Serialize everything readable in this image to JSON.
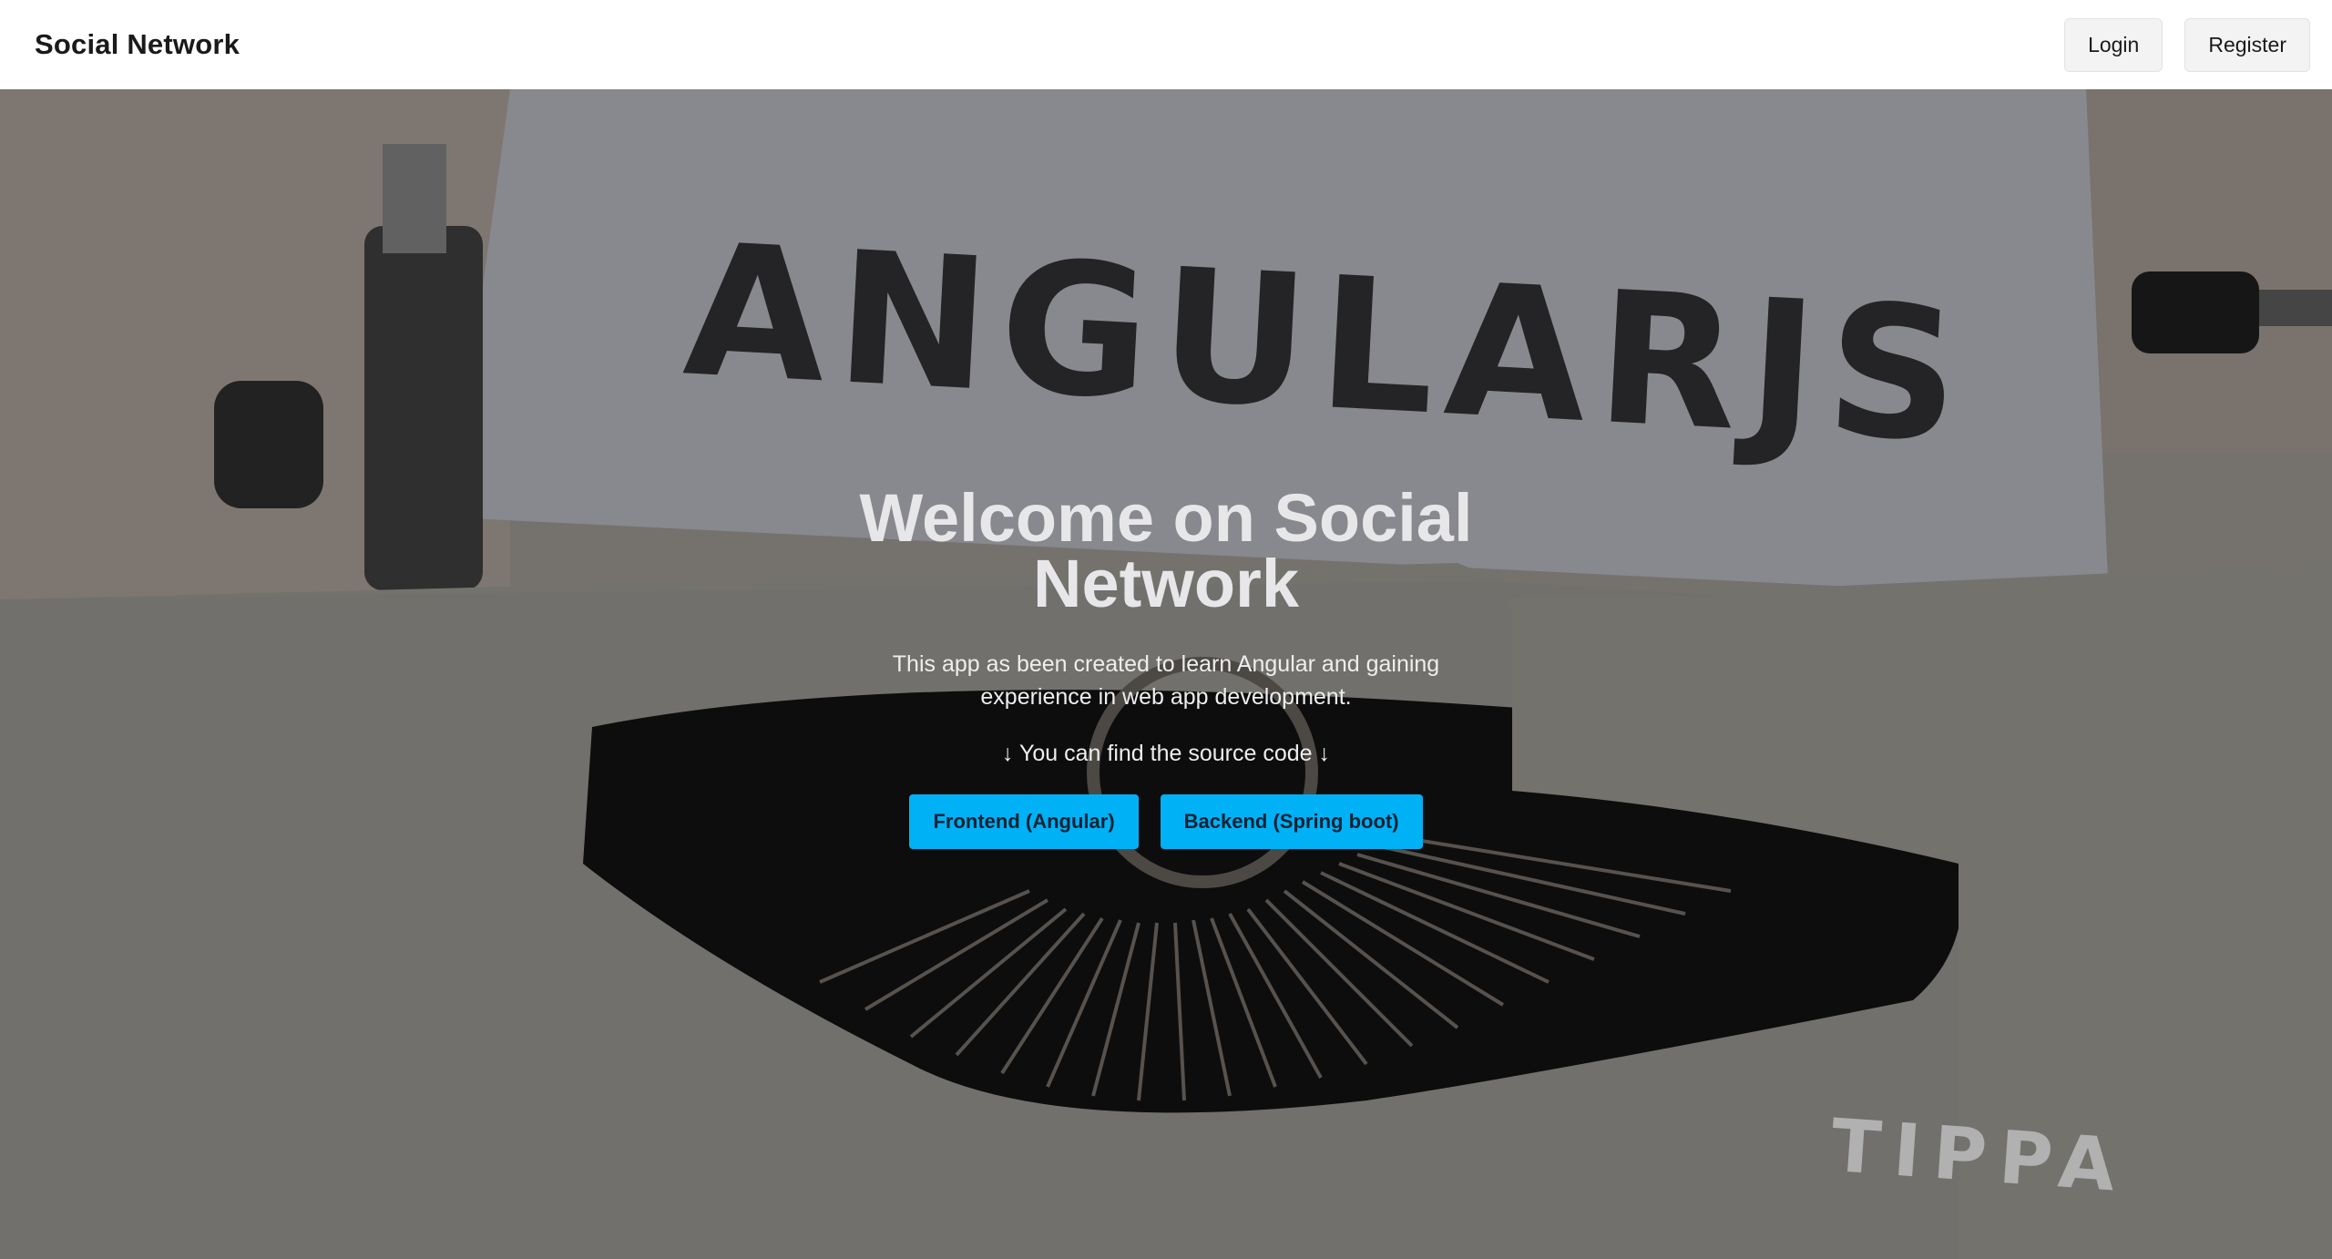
{
  "navbar": {
    "brand": "Social Network",
    "login_label": "Login",
    "register_label": "Register"
  },
  "hero": {
    "background_text": "ANGULARJS",
    "background_brand": "TIPPA",
    "title": "Welcome on Social Network",
    "description": "This app as been created to learn Angular and gaining experience in web app development.",
    "source_text": "↓ You can find the source code ↓",
    "buttons": {
      "frontend_label": "Frontend (Angular)",
      "backend_label": "Backend (Spring boot)"
    }
  },
  "colors": {
    "accent": "#00b1f5",
    "navbar_bg": "#ffffff",
    "button_bg": "#f3f3f3"
  }
}
